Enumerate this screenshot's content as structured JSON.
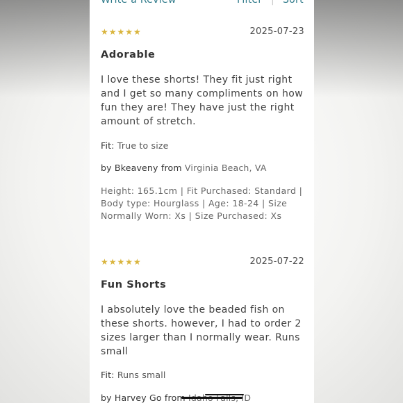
{
  "toolbar": {
    "write_review": "Write a Review",
    "filter": "Filter",
    "separator": "|",
    "sort": "Sort"
  },
  "reviews": [
    {
      "stars": "★★★★★",
      "rating": 5,
      "date": "2025-07-23",
      "title": "Adorable",
      "body": "I love these shorts!   They fit just right and I get so many compliments on how fun they are!  They have just the right amount of stretch.",
      "fit_label": "Fit:",
      "fit_value": "True to size",
      "by_label": "by",
      "author": "Bkeaveny",
      "from_label": "from",
      "location": "Virginia Beach, VA",
      "attributes": "Height: 165.1cm   |   Fit Purchased: Standard   |   Body type: Hourglass   |   Age: 18-24   |   Size Normally Worn: Xs   |   Size Purchased: Xs"
    },
    {
      "stars": "★★★★★",
      "rating": 5,
      "date": "2025-07-22",
      "title": "Fun Shorts",
      "body": "I absolutely love the beaded fish on these shorts.  however, I had to order 2 sizes larger than I normally wear.  Runs small",
      "fit_label": "Fit:",
      "fit_value": "Runs small",
      "by_label": "by",
      "author": "Harvey Go",
      "from_label": "from",
      "location": "Idaho Falls, ID"
    }
  ],
  "colors": {
    "star": "#d9b43c",
    "link": "#2f7a8a",
    "redaction": "#111111"
  }
}
